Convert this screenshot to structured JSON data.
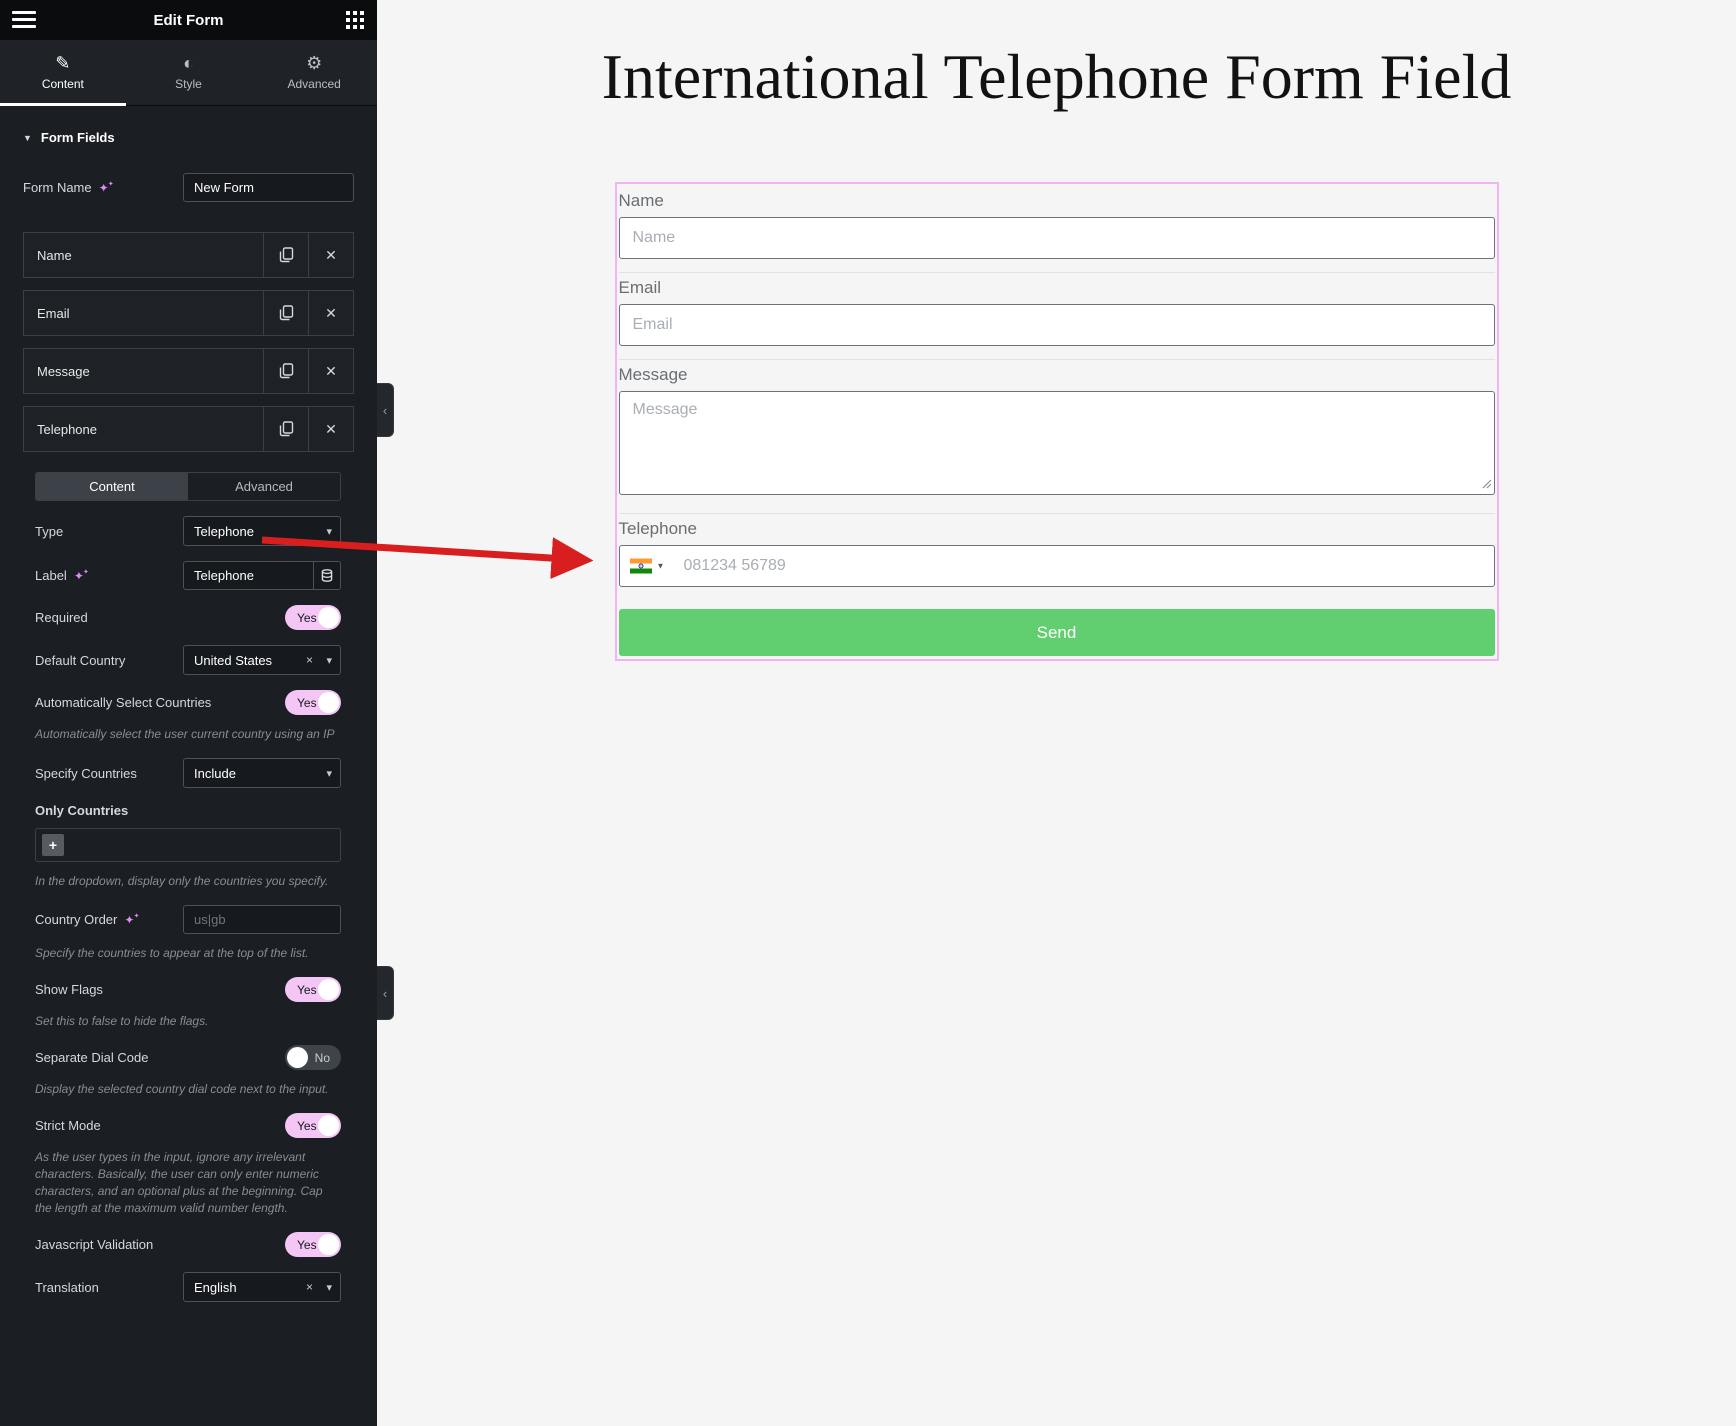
{
  "panel": {
    "title": "Edit Form",
    "tabs": [
      {
        "label": "Content"
      },
      {
        "label": "Style"
      },
      {
        "label": "Advanced"
      }
    ],
    "section_title": "Form Fields",
    "form_name": {
      "label": "Form Name",
      "value": "New Form"
    },
    "fields": [
      "Name",
      "Email",
      "Message",
      "Telephone"
    ],
    "field_editor": {
      "tabs": [
        "Content",
        "Advanced"
      ],
      "active_tab": "Content",
      "controls": {
        "type": {
          "label": "Type",
          "value": "Telephone"
        },
        "field_label": {
          "label": "Label",
          "value": "Telephone"
        },
        "required": {
          "label": "Required",
          "value": "Yes"
        },
        "default_country": {
          "label": "Default Country",
          "value": "United States"
        },
        "auto_select": {
          "label": "Automatically Select Countries",
          "value": "Yes",
          "description": "Automatically select the user current country using an IP"
        },
        "specify_countries": {
          "label": "Specify Countries",
          "value": "Include"
        },
        "only_countries": {
          "label": "Only Countries",
          "description": "In the dropdown, display only the countries you specify."
        },
        "country_order": {
          "label": "Country Order",
          "placeholder": "us|gb",
          "description": "Specify the countries to appear at the top of the list."
        },
        "show_flags": {
          "label": "Show Flags",
          "value": "Yes",
          "description": "Set this to false to hide the flags."
        },
        "separate_dial_code": {
          "label": "Separate Dial Code",
          "value": "No",
          "description": "Display the selected country dial code next to the input."
        },
        "strict_mode": {
          "label": "Strict Mode",
          "value": "Yes",
          "description": "As the user types in the input, ignore any irrelevant characters. Basically, the user can only enter numeric characters, and an optional plus at the beginning. Cap the length at the maximum valid number length."
        },
        "javascript_validation": {
          "label": "Javascript Validation",
          "value": "Yes"
        },
        "translation": {
          "label": "Translation",
          "value": "English"
        }
      }
    }
  },
  "preview": {
    "title": "International Telephone Form Field",
    "form": {
      "fields": [
        {
          "label": "Name",
          "placeholder": "Name",
          "type": "text"
        },
        {
          "label": "Email",
          "placeholder": "Email",
          "type": "text"
        },
        {
          "label": "Message",
          "placeholder": "Message",
          "type": "textarea"
        },
        {
          "label": "Telephone",
          "placeholder": "081234 56789",
          "type": "tel",
          "flag": "india"
        }
      ],
      "submit_label": "Send"
    }
  },
  "icons": {
    "close_glyph": "✕",
    "chevron_glyph": "▾",
    "remove_glyph": "×",
    "plus_glyph": "+",
    "collapse_glyph": "‹",
    "section_triangle_glyph": "▼",
    "sparkle_glyph": "✦",
    "content_tab_glyph": "✎",
    "style_tab_glyph": "◐",
    "advanced_tab_glyph": "⚙",
    "flag_chevron_glyph": "▼"
  },
  "colors": {
    "toggle_on_pink": "#f4c6f6",
    "toggle_off_gray": "#3f444b",
    "send_button_green": "#61ce70",
    "widget_outline_pink": "#f2b3f2",
    "annotation_arrow_red": "#d81e1e",
    "ai_sparkle_purple": "#e18bf2",
    "panel_header_black": "#0a0c0d",
    "panel_background": "#1b1e22"
  }
}
